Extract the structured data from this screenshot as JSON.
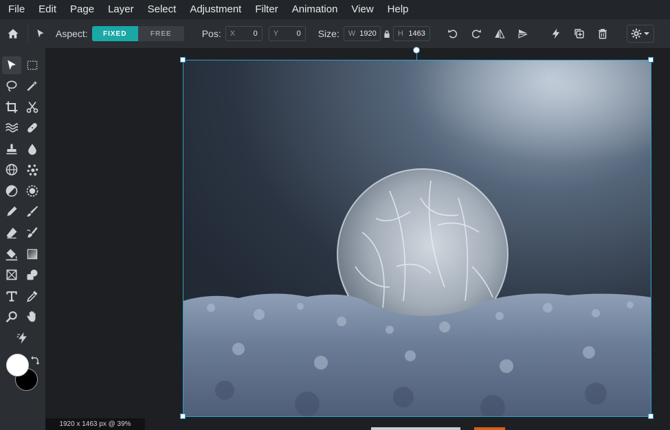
{
  "menu": [
    "File",
    "Edit",
    "Page",
    "Layer",
    "Select",
    "Adjustment",
    "Filter",
    "Animation",
    "View",
    "Help"
  ],
  "toolbar": {
    "aspect_label": "Aspect:",
    "aspect_fixed": "FIXED",
    "aspect_free": "FREE",
    "pos_label": "Pos:",
    "pos_x_key": "X",
    "pos_x": "0",
    "pos_y_key": "Y",
    "pos_y": "0",
    "size_label": "Size:",
    "size_w_key": "W",
    "size_w": "1920",
    "size_h_key": "H",
    "size_h": "1463"
  },
  "status": {
    "text": "1920 x 1463 px @ 39%"
  },
  "colors": {
    "accent": "#19a8a6",
    "selection": "#2fa0c6",
    "foreground": "#ffffff",
    "background": "#000000"
  },
  "tools": [
    "move-tool",
    "marquee-tool",
    "lasso-tool",
    "magic-wand-tool",
    "crop-tool",
    "cut-tool",
    "liquify-tool",
    "healing-tool",
    "clone-stamp-tool",
    "blur-tool",
    "sphere-tool",
    "pattern-tool",
    "dodge-tool",
    "sponge-tool",
    "pencil-tool",
    "brush-tool",
    "eraser-tool",
    "smudge-tool",
    "fill-tool",
    "gradient-tool",
    "shape-tool",
    "cloud-tool",
    "text-tool",
    "eyedropper-tool",
    "zoom-tool",
    "hand-tool",
    "quick-action-tool"
  ]
}
